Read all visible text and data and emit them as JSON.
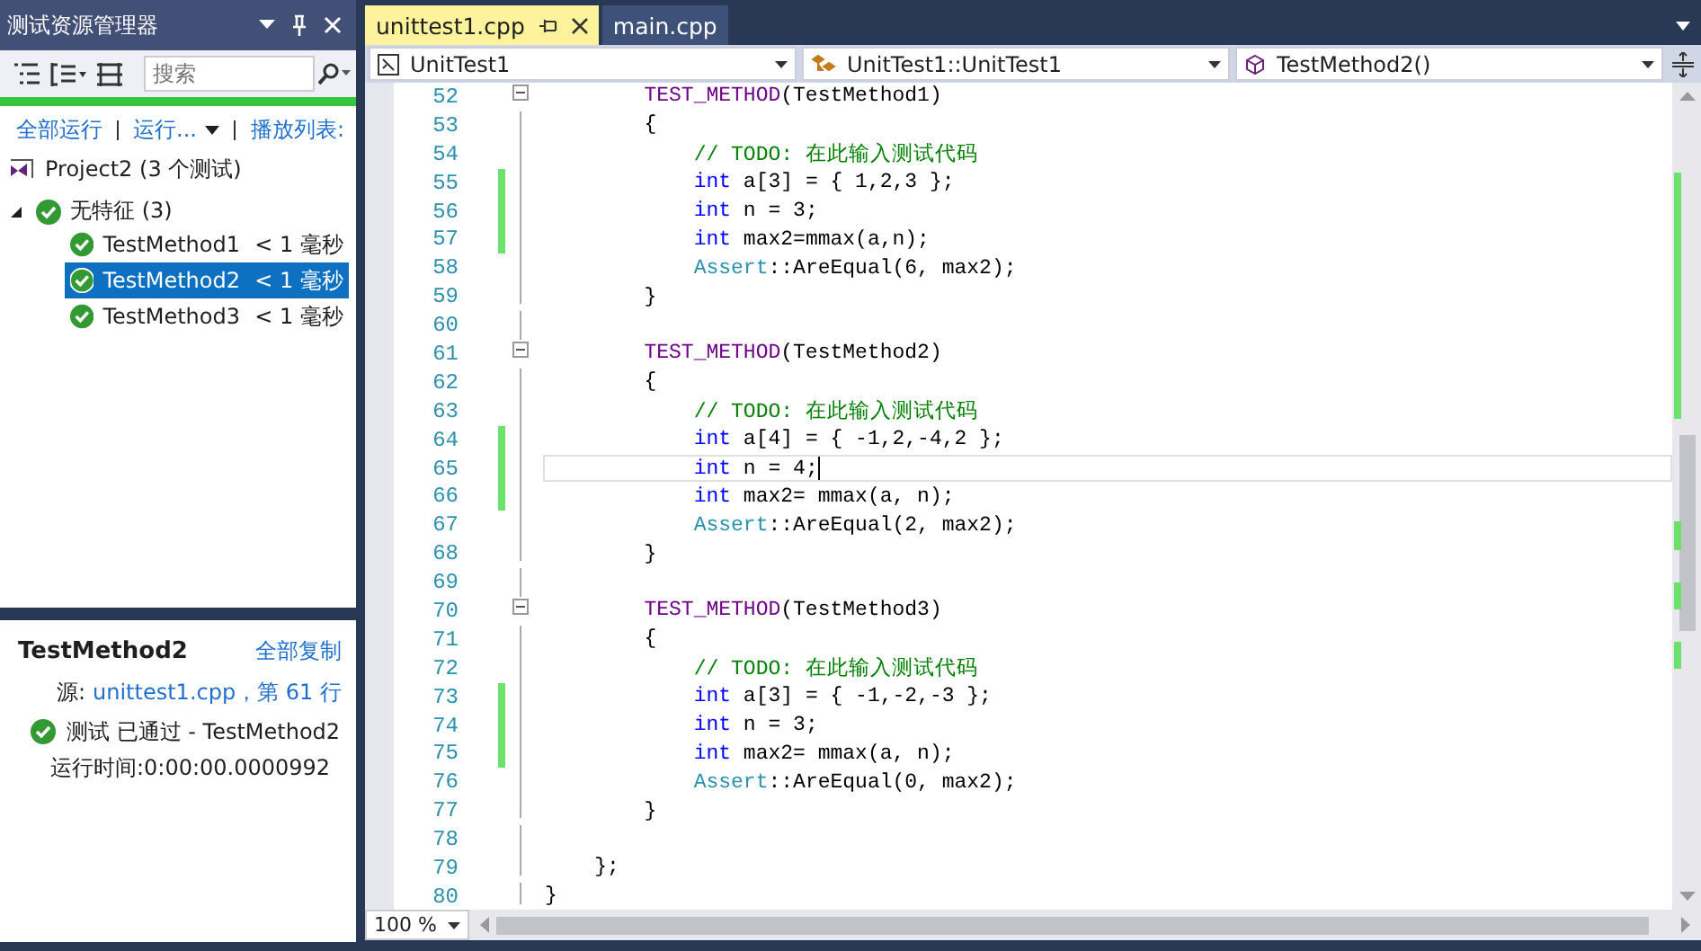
{
  "explorer": {
    "title": "测试资源管理器",
    "search": {
      "placeholder": "搜索"
    },
    "run_passed": true,
    "actions": [
      "全部运行",
      "运行...",
      "播放列表:"
    ],
    "project": "Project2 (3 个测试)",
    "groups": [
      {
        "label": "无特征 (3)",
        "expanded": true,
        "passed": true,
        "children": [
          {
            "name": "TestMethod1",
            "duration": "< 1 毫秒",
            "selected": false,
            "passed": true
          },
          {
            "name": "TestMethod2",
            "duration": "< 1 毫秒",
            "selected": true,
            "passed": true
          },
          {
            "name": "TestMethod3",
            "duration": "< 1 毫秒",
            "selected": false,
            "passed": true
          }
        ]
      }
    ],
    "detail": {
      "title": "TestMethod2",
      "copy": "全部复制",
      "source_label": "源:",
      "source_link": "unittest1.cpp，第 61 行",
      "status": "测试 已通过 - TestMethod2",
      "passed": true,
      "elapsed": "运行时间:0:00:00.0000992"
    }
  },
  "editor": {
    "tabs": [
      {
        "label": "unittest1.cpp",
        "selected": true
      },
      {
        "label": "main.cpp",
        "selected": false
      }
    ],
    "nav": [
      "UnitTest1",
      "UnitTest1::UnitTest1",
      "TestMethod2()"
    ],
    "lines": [
      {
        "n": "52",
        "changed": false,
        "current": false,
        "kind": "start",
        "segs": [
          {
            "kind": "macro",
            "text": "        TEST_METHOD"
          },
          {
            "kind": "plain",
            "text": "(TestMethod1)"
          }
        ]
      },
      {
        "n": "53",
        "changed": false,
        "current": false,
        "kind": "body",
        "segs": [
          {
            "kind": "plain",
            "text": "        {"
          }
        ]
      },
      {
        "n": "54",
        "changed": false,
        "current": false,
        "kind": "body",
        "segs": [
          {
            "kind": "comment",
            "text": "            // TODO: 在此输入测试代码"
          }
        ]
      },
      {
        "n": "55",
        "changed": true,
        "current": false,
        "kind": "body",
        "segs": [
          {
            "kind": "keyword",
            "text": "            int"
          },
          {
            "kind": "plain",
            "text": " a[3] = { 1,2,3 };"
          }
        ]
      },
      {
        "n": "56",
        "changed": true,
        "current": false,
        "kind": "body",
        "segs": [
          {
            "kind": "keyword",
            "text": "            int"
          },
          {
            "kind": "plain",
            "text": " n = 3;"
          }
        ]
      },
      {
        "n": "57",
        "changed": true,
        "current": false,
        "kind": "body",
        "segs": [
          {
            "kind": "keyword",
            "text": "            int"
          },
          {
            "kind": "plain",
            "text": " max2=mmax(a,n);"
          }
        ]
      },
      {
        "n": "58",
        "changed": false,
        "current": false,
        "kind": "body",
        "segs": [
          {
            "kind": "type",
            "text": "            Assert"
          },
          {
            "kind": "plain",
            "text": "::AreEqual(6, max2);"
          }
        ]
      },
      {
        "n": "59",
        "changed": false,
        "current": false,
        "kind": "end",
        "segs": [
          {
            "kind": "plain",
            "text": "        }"
          }
        ]
      },
      {
        "n": "60",
        "changed": false,
        "current": false,
        "kind": "body"
      },
      {
        "n": "61",
        "changed": false,
        "current": false,
        "kind": "start",
        "segs": [
          {
            "kind": "macro",
            "text": "        TEST_METHOD"
          },
          {
            "kind": "plain",
            "text": "(TestMethod2)"
          }
        ]
      },
      {
        "n": "62",
        "changed": false,
        "current": false,
        "kind": "body",
        "segs": [
          {
            "kind": "plain",
            "text": "        {"
          }
        ]
      },
      {
        "n": "63",
        "changed": false,
        "current": false,
        "kind": "body",
        "segs": [
          {
            "kind": "comment",
            "text": "            // TODO: 在此输入测试代码"
          }
        ]
      },
      {
        "n": "64",
        "changed": true,
        "current": false,
        "kind": "body",
        "segs": [
          {
            "kind": "keyword",
            "text": "            int"
          },
          {
            "kind": "plain",
            "text": " a[4] = { -1,2,-4,2 };"
          }
        ]
      },
      {
        "n": "65",
        "changed": true,
        "current": true,
        "kind": "body",
        "segs": [
          {
            "kind": "keyword",
            "text": "            int"
          },
          {
            "kind": "plain",
            "text": " n = 4;"
          }
        ]
      },
      {
        "n": "66",
        "changed": true,
        "current": false,
        "kind": "body",
        "segs": [
          {
            "kind": "keyword",
            "text": "            int"
          },
          {
            "kind": "plain",
            "text": " max2= mmax(a, n);"
          }
        ]
      },
      {
        "n": "67",
        "changed": false,
        "current": false,
        "kind": "body",
        "segs": [
          {
            "kind": "type",
            "text": "            Assert"
          },
          {
            "kind": "plain",
            "text": "::AreEqual(2, max2);"
          }
        ]
      },
      {
        "n": "68",
        "changed": false,
        "current": false,
        "kind": "end",
        "segs": [
          {
            "kind": "plain",
            "text": "        }"
          }
        ]
      },
      {
        "n": "69",
        "changed": false,
        "current": false,
        "kind": "body"
      },
      {
        "n": "70",
        "changed": false,
        "current": false,
        "kind": "start",
        "segs": [
          {
            "kind": "macro",
            "text": "        TEST_METHOD"
          },
          {
            "kind": "plain",
            "text": "(TestMethod3)"
          }
        ]
      },
      {
        "n": "71",
        "changed": false,
        "current": false,
        "kind": "body",
        "segs": [
          {
            "kind": "plain",
            "text": "        {"
          }
        ]
      },
      {
        "n": "72",
        "changed": false,
        "current": false,
        "kind": "body",
        "segs": [
          {
            "kind": "comment",
            "text": "            // TODO: 在此输入测试代码"
          }
        ]
      },
      {
        "n": "73",
        "changed": true,
        "current": false,
        "kind": "body",
        "segs": [
          {
            "kind": "keyword",
            "text": "            int"
          },
          {
            "kind": "plain",
            "text": " a[3] = { -1,-2,-3 };"
          }
        ]
      },
      {
        "n": "74",
        "changed": true,
        "current": false,
        "kind": "body",
        "segs": [
          {
            "kind": "keyword",
            "text": "            int"
          },
          {
            "kind": "plain",
            "text": " n = 3;"
          }
        ]
      },
      {
        "n": "75",
        "changed": true,
        "current": false,
        "kind": "body",
        "segs": [
          {
            "kind": "keyword",
            "text": "            int"
          },
          {
            "kind": "plain",
            "text": " max2= mmax(a, n);"
          }
        ]
      },
      {
        "n": "76",
        "changed": false,
        "current": false,
        "kind": "body",
        "segs": [
          {
            "kind": "type",
            "text": "            Assert"
          },
          {
            "kind": "plain",
            "text": "::AreEqual(0, max2);"
          }
        ]
      },
      {
        "n": "77",
        "changed": false,
        "current": false,
        "kind": "end",
        "segs": [
          {
            "kind": "plain",
            "text": "        }"
          }
        ]
      },
      {
        "n": "78",
        "changed": false,
        "current": false,
        "kind": "body"
      },
      {
        "n": "79",
        "changed": false,
        "current": false,
        "kind": "end",
        "segs": [
          {
            "kind": "plain",
            "text": "    };"
          }
        ]
      },
      {
        "n": "80",
        "changed": false,
        "current": false,
        "kind": "end",
        "segs": [
          {
            "kind": "plain",
            "text": "}"
          }
        ]
      }
    ],
    "zoom": "100 %"
  }
}
